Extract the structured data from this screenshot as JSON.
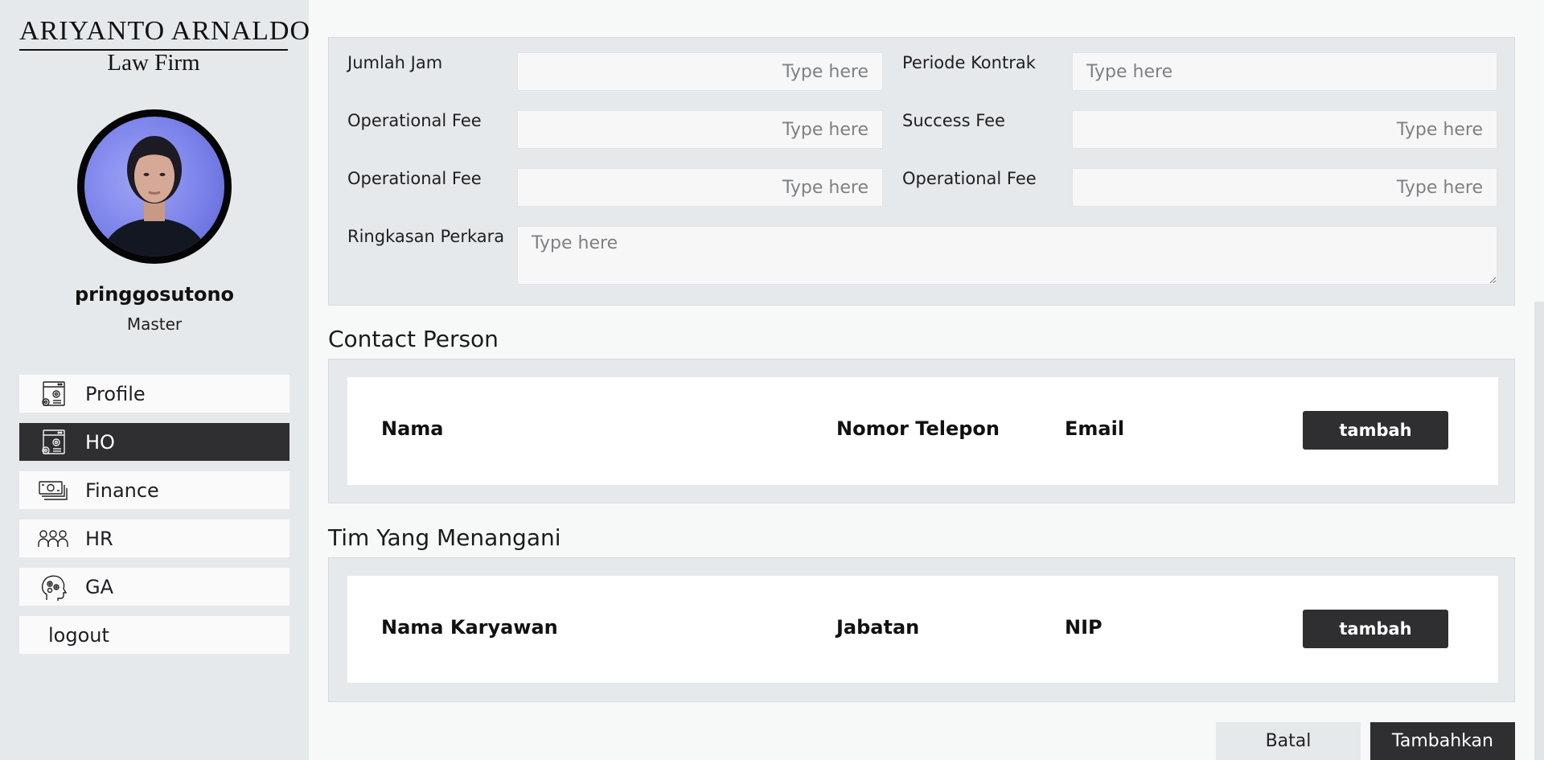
{
  "brand": {
    "name_line1": "ARIYANTO ARNALDO",
    "name_line2": "Law Firm"
  },
  "user": {
    "username": "pringgosutono",
    "role": "Master"
  },
  "sidebar": {
    "items": [
      {
        "label": "Profile",
        "icon": "settings-page-icon",
        "active": false
      },
      {
        "label": "HO",
        "icon": "settings-page-icon",
        "active": true
      },
      {
        "label": "Finance",
        "icon": "money-stack-icon",
        "active": false
      },
      {
        "label": "HR",
        "icon": "people-group-icon",
        "active": false
      },
      {
        "label": "GA",
        "icon": "head-gears-icon",
        "active": false
      }
    ],
    "logout_label": "logout"
  },
  "form": {
    "jumlah_jam": {
      "label": "Jumlah Jam",
      "placeholder": "Type here"
    },
    "periode_kontrak": {
      "label": "Periode Kontrak",
      "placeholder": "Type here"
    },
    "operational_fee_1": {
      "label": "Operational Fee",
      "placeholder": "Type here"
    },
    "success_fee": {
      "label": "Success Fee",
      "placeholder": "Type here"
    },
    "operational_fee_2": {
      "label": "Operational Fee",
      "placeholder": "Type here"
    },
    "operational_fee_3": {
      "label": "Operational Fee",
      "placeholder": "Type here"
    },
    "ringkasan_perkara": {
      "label": "Ringkasan Perkara",
      "placeholder": "Type here"
    }
  },
  "contact_person": {
    "title": "Contact Person",
    "columns": [
      "Nama",
      "Nomor Telepon",
      "Email"
    ],
    "add_label": "tambah"
  },
  "team": {
    "title": "Tim Yang Menangani",
    "columns": [
      "Nama Karyawan",
      "Jabatan",
      "NIP"
    ],
    "add_label": "tambah"
  },
  "actions": {
    "cancel_label": "Batal",
    "submit_label": "Tambahkan"
  },
  "colors": {
    "sidebar_bg": "#e6e9ec",
    "active_nav": "#2f2f31",
    "button_dark": "#2f2f31",
    "page_bg": "#f7f8f8"
  }
}
